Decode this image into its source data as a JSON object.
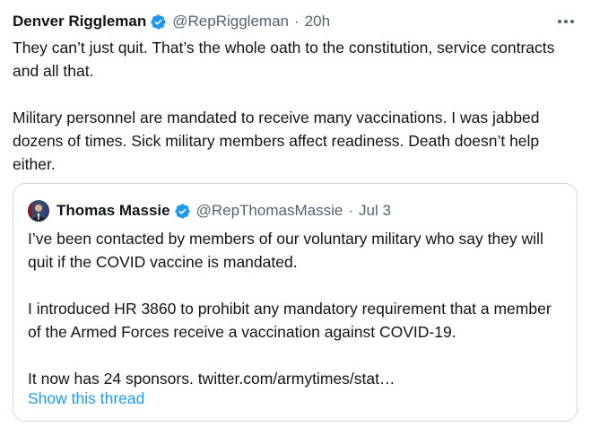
{
  "tweet": {
    "author_name": "Denver Riggleman",
    "handle": "@RepRiggleman",
    "separator": "·",
    "time": "20h",
    "paragraphs": [
      "They can’t just quit. That’s the whole oath to the constitution, service contracts and all that.",
      "Military personnel are mandated to receive many vaccinations. I was jabbed dozens of times. Sick military members affect readiness. Death doesn’t help either."
    ]
  },
  "quoted_tweet": {
    "author_name": "Thomas Massie",
    "handle": "@RepThomasMassie",
    "separator": "·",
    "date": "Jul 3",
    "paragraphs": [
      "I’ve been contacted by members of our voluntary military who say they will quit if the COVID vaccine is mandated.",
      "I introduced HR 3860 to prohibit any mandatory requirement that a member of the Armed Forces receive a vaccination against COVID-19.",
      "It now has 24 sponsors. twitter.com/armytimes/stat…"
    ],
    "show_thread_label": "Show this thread"
  },
  "icons": {
    "verified": "verified-badge-icon",
    "more": "more-options-icon"
  },
  "colors": {
    "text": "#0f1419",
    "secondary": "#536471",
    "accent": "#1d9bf0",
    "border": "#cfd9de"
  }
}
